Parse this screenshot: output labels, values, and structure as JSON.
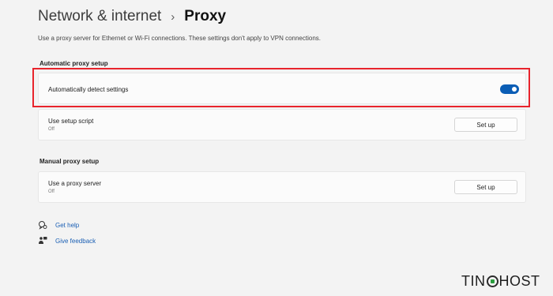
{
  "breadcrumb": {
    "parent": "Network & internet",
    "separator": "›",
    "current": "Proxy"
  },
  "description": "Use a proxy server for Ethernet or Wi-Fi connections. These settings don't apply to VPN connections.",
  "automatic": {
    "section_title": "Automatic proxy setup",
    "detect": {
      "label": "Automatically detect settings",
      "toggle_label": "On",
      "toggle_on": true
    },
    "script": {
      "label": "Use setup script",
      "status": "Off",
      "button": "Set up"
    }
  },
  "manual": {
    "section_title": "Manual proxy setup",
    "proxy": {
      "label": "Use a proxy server",
      "status": "Off",
      "button": "Set up"
    }
  },
  "links": {
    "help": {
      "label": "Get help",
      "icon": "help-icon"
    },
    "feedback": {
      "label": "Give feedback",
      "icon": "feedback-icon"
    }
  },
  "watermark": {
    "text_left": "TIN",
    "text_right": "HOST"
  },
  "colors": {
    "accent": "#0a5db5",
    "highlight_border": "#e8242c",
    "link": "#1a5fb4",
    "background": "#f3f3f3"
  }
}
